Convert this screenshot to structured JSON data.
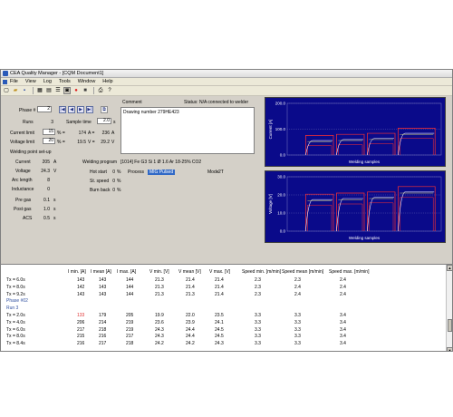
{
  "window": {
    "title": "CEA Quality Manager - [CQM Document1]"
  },
  "menu": {
    "items": [
      "File",
      "View",
      "Log",
      "Tools",
      "Window",
      "Help"
    ]
  },
  "phase": {
    "label": "Phase #",
    "value": "2",
    "runs_label": "Runs",
    "runs_value": "3",
    "sample_time_label": "Sample time",
    "sample_time_value": "2.0",
    "sample_time_unit": "s"
  },
  "limits": {
    "current_label": "Current limit",
    "current_pct": "15",
    "current_pct_unit": "% =",
    "current_value": "174",
    "current_unit": "A =",
    "current_abs": "236",
    "current_abs_unit": "A",
    "voltage_label": "Voltage limit",
    "voltage_pct": "20",
    "voltage_pct_unit": "% =",
    "voltage_value": "19.5",
    "voltage_unit": "V =",
    "voltage_abs": "29.2",
    "voltage_abs_unit": "V"
  },
  "comment": {
    "label": "Comment",
    "text": "Drawing number 279HE423"
  },
  "status": {
    "text": "Status: N/A connected to welder"
  },
  "setup": {
    "title": "Welding point set-up",
    "current_label": "Current",
    "current_value": "205",
    "current_unit": "A",
    "voltage_label": "Voltage",
    "voltage_value": "24.3",
    "voltage_unit": "V",
    "arc_length_label": "Arc length",
    "arc_length_value": "8",
    "inductance_label": "Inductance",
    "inductance_value": "0",
    "pre_gas_label": "Pre gas",
    "pre_gas_value": "0.1",
    "pre_gas_unit": "s",
    "post_gas_label": "Post gas",
    "post_gas_value": "1.0",
    "post_gas_unit": "s",
    "acs_label": "ACS",
    "acs_value": "0.5",
    "acs_unit": "s"
  },
  "program": {
    "label": "Welding program",
    "value": "[1014] Fe G3 Si 1 Ø 1.6 Ar 18-25% CO2",
    "hot_start_label": "Hot start",
    "hot_start_value": "0",
    "hot_start_unit": "%",
    "st_speed_label": "St. speed",
    "st_speed_value": "0",
    "st_speed_unit": "%",
    "burn_back_label": "Burn back",
    "burn_back_value": "0",
    "burn_back_unit": "%",
    "process_label": "Process",
    "process_value": "MIG Pulsed",
    "mode_label": "Mode",
    "mode_value": "2T"
  },
  "chart_data": [
    {
      "type": "line",
      "ylabel": "Current [A]",
      "xlabel": "Welding samples",
      "y_ticks": [
        "200.0",
        "100.0",
        "0.0"
      ],
      "ylim": [
        0,
        200
      ],
      "colors": {
        "background": "#0a0a8a",
        "grid": "#6a6ab8",
        "upper": "#ff3030",
        "lower": "#ff3030",
        "measured": "#e8e8ff",
        "nominal": "#ffff60"
      },
      "series": [
        {
          "values": [
            0,
            45,
            47,
            46,
            0,
            0,
            0,
            0,
            0,
            0,
            0,
            0,
            0,
            0,
            0,
            0,
            0,
            0,
            0,
            0,
            0,
            0,
            0,
            0,
            0,
            0,
            0,
            0,
            0,
            0
          ]
        }
      ]
    },
    {
      "type": "line",
      "ylabel": "Voltage [V]",
      "xlabel": "Welding samples",
      "y_ticks": [
        "30.0",
        "20.0",
        "10.0",
        "0.0"
      ],
      "ylim": [
        0,
        30
      ],
      "colors": {
        "background": "#0a0a8a",
        "grid": "#6a6ab8",
        "upper": "#ff3030",
        "lower": "#ff3030",
        "measured": "#e8e8ff",
        "nominal": "#ffff60"
      }
    }
  ],
  "table": {
    "headers": [
      "I min. [A]",
      "I mean [A]",
      "I max. [A]",
      "V min. [V]",
      "V mean [V]",
      "V max. [V]",
      "Speed min. [m/min]",
      "Speed mean [m/min]",
      "Speed max. [m/min]"
    ],
    "rows": [
      {
        "label": "Tx = 6.0s",
        "cells": [
          "143",
          "143",
          "144",
          "21.3",
          "21.4",
          "21.4",
          "2.3",
          "2.3",
          "2.4"
        ]
      },
      {
        "label": "Tx = 8.0s",
        "cells": [
          "142",
          "143",
          "144",
          "21.3",
          "21.4",
          "21.4",
          "2.3",
          "2.4",
          "2.4"
        ]
      },
      {
        "label": "Tx = 9.2s",
        "cells": [
          "143",
          "143",
          "144",
          "21.3",
          "21.3",
          "21.4",
          "2.3",
          "2.4",
          "2.4"
        ]
      },
      {
        "label": "Phase #02",
        "cells": [],
        "kind": "phase"
      },
      {
        "label": "Run 3",
        "cells": [],
        "kind": "run"
      },
      {
        "label": "Tx = 2.0s",
        "cells": [
          "133",
          "179",
          "205",
          "19.9",
          "22.0",
          "23.5",
          "3.3",
          "3.3",
          "3.4"
        ],
        "alert": true
      },
      {
        "label": "Tx = 4.0s",
        "cells": [
          "206",
          "214",
          "219",
          "23.6",
          "23.9",
          "24.1",
          "3.3",
          "3.3",
          "3.4"
        ]
      },
      {
        "label": "Tx = 6.0s",
        "cells": [
          "217",
          "218",
          "219",
          "24.3",
          "24.4",
          "24.5",
          "3.3",
          "3.3",
          "3.4"
        ]
      },
      {
        "label": "Tx = 8.0s",
        "cells": [
          "215",
          "216",
          "217",
          "24.3",
          "24.4",
          "24.5",
          "3.3",
          "3.3",
          "3.4"
        ]
      },
      {
        "label": "Tx = 8.4s",
        "cells": [
          "216",
          "217",
          "218",
          "24.2",
          "24.2",
          "24.3",
          "3.3",
          "3.3",
          "3.4"
        ]
      }
    ]
  }
}
